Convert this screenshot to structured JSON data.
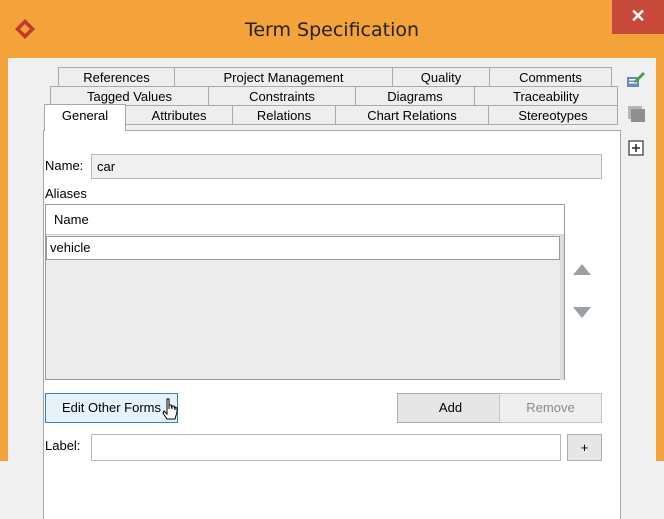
{
  "window": {
    "title": "Term Specification",
    "close_glyph": "✕",
    "icon": "app-diamond-icon"
  },
  "tabs": {
    "row1": [
      "References",
      "Project Management",
      "Quality",
      "Comments"
    ],
    "row2": [
      "Tagged Values",
      "Constraints",
      "Diagrams",
      "Traceability"
    ],
    "row3": [
      "General",
      "Attributes",
      "Relations",
      "Chart Relations",
      "Stereotypes"
    ],
    "active": "General"
  },
  "general": {
    "name_label": "Name:",
    "name_value": "car",
    "aliases_label": "Aliases",
    "aliases_table": {
      "columns": [
        "Name"
      ],
      "rows": [
        "vehicle"
      ]
    },
    "edit_other_forms_button": "Edit Other Forms",
    "add_button": "Add",
    "remove_button": "Remove",
    "label_label": "Label:",
    "label_value": "",
    "plus_button": "+"
  },
  "side_toolbar": {
    "icons": [
      "edit-icon",
      "stamp-icon",
      "add-box-icon"
    ]
  },
  "colors": {
    "title_bar": "#f4a23a",
    "close_button": "#c74a3a",
    "arrows": "#9aa0a6"
  }
}
